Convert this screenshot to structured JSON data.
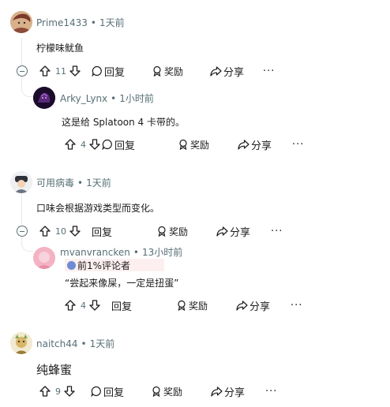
{
  "comments": [
    {
      "author": "Prime1433",
      "time": "1天前",
      "body": "柠檬味鱿鱼",
      "votes": "11",
      "reply": "回复",
      "award": "奖励",
      "share": "分享",
      "more": "···"
    },
    {
      "author": "Arky_Lynx",
      "time": "1小时前",
      "body": "这是给 Splatoon 4 卡带的。",
      "votes": "4",
      "reply": "回复",
      "award": "奖励",
      "share": "分享",
      "more": "···"
    },
    {
      "author": "可用病毒",
      "time": "1天前",
      "body": "口味会根据游戏类型而变化。",
      "votes": "10",
      "reply": "回复",
      "award": "奖励",
      "share": "分享",
      "more": "···"
    },
    {
      "author": "mvanvrancken",
      "time": "13小时前",
      "flair": "前1%评论者",
      "body": "“尝起来像屎，一定是扭蛋”",
      "votes": "4",
      "reply": "回复",
      "award": "奖励",
      "share": "分享",
      "more": "···"
    },
    {
      "author": "naitch44",
      "time": "1天前",
      "body": "纯蜂蜜",
      "votes": "9",
      "reply": "回复",
      "award": "奖励",
      "share": "分享",
      "more": "···"
    }
  ],
  "meta_separator": "•"
}
